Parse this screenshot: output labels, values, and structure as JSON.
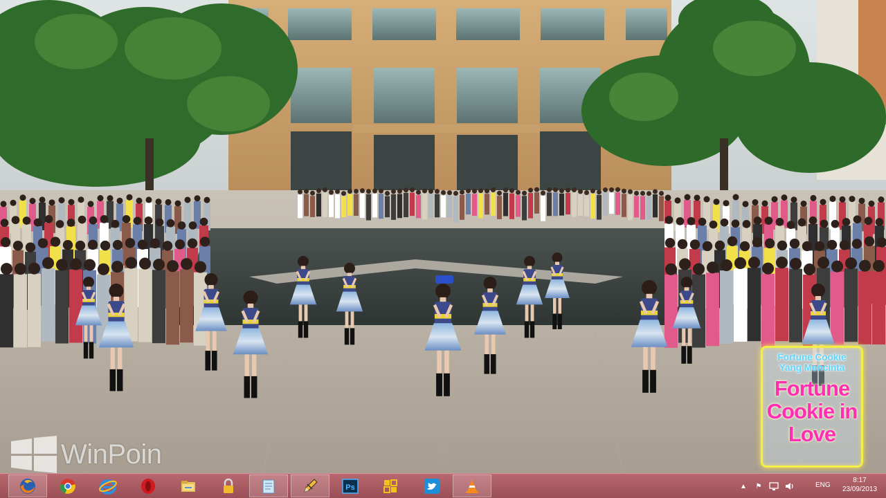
{
  "screen": {
    "wallpaper_icon": "video-frame-dance-performance"
  },
  "watermark": {
    "text": "WinPoin",
    "icon": "windows-logo-icon"
  },
  "title_art": {
    "subtitle": "Fortune Cookie Yang Mencinta",
    "title": "Fortune Cookie in Love",
    "colors": {
      "title": "#ff2fb4",
      "subtitle": "#59d6ff",
      "border": "#f4ee4a"
    }
  },
  "taskbar": {
    "color": "#a8585f",
    "pinned": [
      {
        "name": "firefox",
        "icon": "firefox-icon",
        "active": true
      },
      {
        "name": "chrome",
        "icon": "chrome-icon",
        "active": false
      },
      {
        "name": "internet-explorer",
        "icon": "internet-explorer-icon",
        "active": false
      },
      {
        "name": "opera",
        "icon": "opera-icon",
        "active": false
      },
      {
        "name": "file-explorer",
        "icon": "folder-icon",
        "active": false
      },
      {
        "name": "locker",
        "icon": "lock-icon",
        "active": false
      },
      {
        "name": "notepad",
        "icon": "notepad-icon",
        "active": true
      },
      {
        "name": "pencil-tool",
        "icon": "pencil-icon",
        "active": true
      },
      {
        "name": "photoshop",
        "icon": "photoshop-icon",
        "label": "Ps",
        "active": false
      },
      {
        "name": "grid-tool",
        "icon": "puzzle-icon",
        "active": false
      },
      {
        "name": "twitter",
        "icon": "twitter-icon",
        "active": false
      },
      {
        "name": "vlc",
        "icon": "vlc-icon",
        "active": true
      }
    ],
    "tray": {
      "language": "ENG",
      "time": "8:17",
      "date": "23/09/2013",
      "icons": [
        "show-hidden-icon",
        "flag-icon",
        "network-icon",
        "volume-icon"
      ]
    }
  }
}
